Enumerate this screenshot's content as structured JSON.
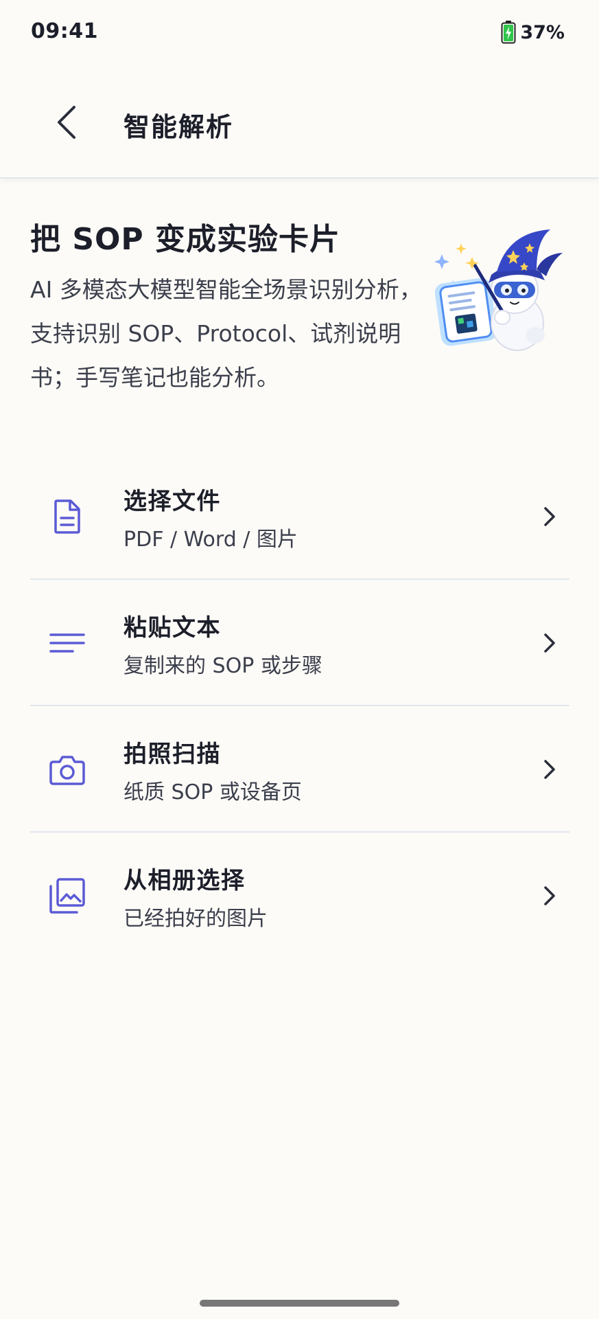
{
  "status_bar": {
    "time": "09:41",
    "battery": "37%"
  },
  "header": {
    "title": "智能解析"
  },
  "hero": {
    "title": "把 SOP 变成实验卡片",
    "description": "AI 多模态大模型智能全场景识别分析，支持识别 SOP、Protocol、试剂说明书；手写笔记也能分析。"
  },
  "options": [
    {
      "title": "选择文件",
      "subtitle": "PDF / Word / 图片",
      "icon": "document-icon"
    },
    {
      "title": "粘贴文本",
      "subtitle": "复制来的 SOP 或步骤",
      "icon": "text-lines-icon"
    },
    {
      "title": "拍照扫描",
      "subtitle": "纸质 SOP 或设备页",
      "icon": "camera-icon"
    },
    {
      "title": "从相册选择",
      "subtitle": "已经拍好的图片",
      "icon": "gallery-icon"
    }
  ],
  "colors": {
    "accent": "#5b5bd6",
    "background": "#fdfbf7",
    "divider": "#e1e6ef",
    "battery_charge": "#2ec54a"
  }
}
